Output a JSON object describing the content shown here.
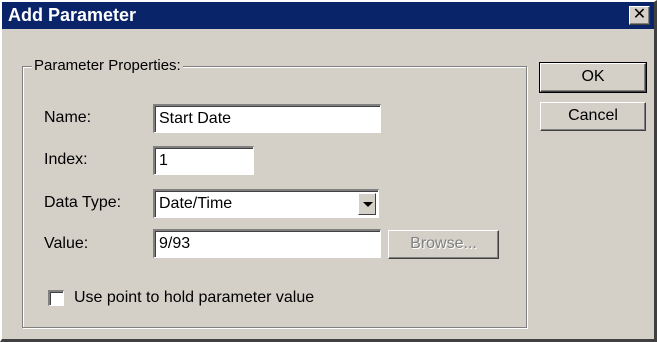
{
  "window": {
    "title": "Add Parameter",
    "close_glyph": "✕"
  },
  "group": {
    "legend": "Parameter Properties:"
  },
  "fields": {
    "name": {
      "label": "Name:",
      "value": "Start Date"
    },
    "index": {
      "label": "Index:",
      "value": "1"
    },
    "data_type": {
      "label": "Data Type:",
      "value": "Date/Time"
    },
    "value": {
      "label": "Value:",
      "value": "9/93"
    }
  },
  "buttons": {
    "ok": "OK",
    "cancel": "Cancel",
    "browse": "Browse..."
  },
  "checkbox": {
    "label": "Use point to hold parameter value",
    "checked": false
  },
  "colors": {
    "face": "#d4d0c8",
    "title_bar": "#0a246a",
    "title_text": "#ffffff",
    "disabled_text": "#808080"
  },
  "icons": {
    "close": "close-icon",
    "dropdown": "chevron-down-icon"
  }
}
